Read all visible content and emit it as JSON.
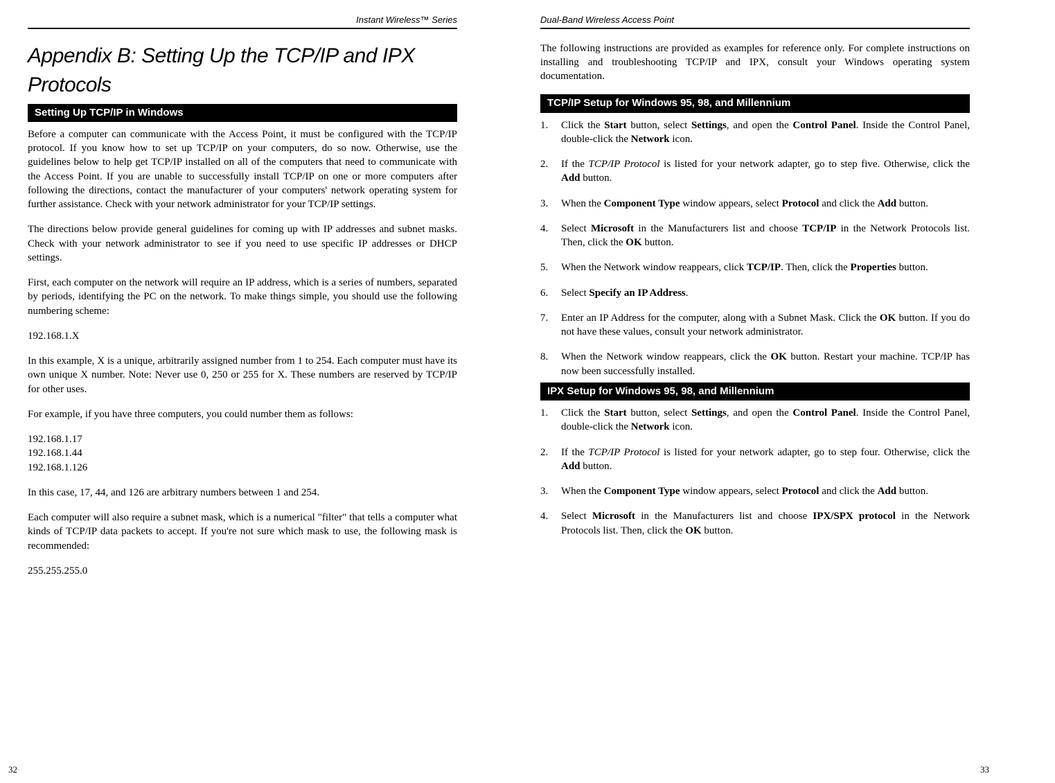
{
  "left": {
    "header": "Instant Wireless™ Series",
    "title": "Appendix B: Setting Up the TCP/IP and IPX Protocols",
    "section1": "Setting Up TCP/IP in Windows",
    "p1": "Before a computer can communicate with the Access Point, it must be configured with the TCP/IP protocol. If you know how to set up TCP/IP on your computers, do so now. Otherwise, use the guidelines below to help get TCP/IP installed on all of the computers that need to communicate with the Access Point. If you are unable to successfully install TCP/IP on one or more computers after following the directions, contact the manufacturer of your computers' network operating system for further assistance. Check with your network administrator for your TCP/IP settings.",
    "p2": "The directions below provide general guidelines for coming up with IP addresses and subnet masks. Check with your network administrator to see if you need to use specific IP addresses or DHCP settings.",
    "p3": "First, each computer on the network will require an IP address, which is a series of numbers, separated by periods, identifying the PC on the network. To make things simple, you should use the following numbering scheme:",
    "ip_scheme": "192.168.1.X",
    "p4": "In this example, X is a unique, arbitrarily assigned number from 1 to 254. Each computer must have its own unique X number. Note: Never use 0, 250 or 255 for X. These numbers are reserved by TCP/IP for other uses.",
    "p5": "For example, if you have three computers, you could number them as follows:",
    "ip1": "192.168.1.17",
    "ip2": "192.168.1.44",
    "ip3": "192.168.1.126",
    "p6": "In this case, 17, 44, and 126 are arbitrary numbers between 1 and 254.",
    "p7": "Each computer will also require a subnet mask, which is a numerical \"filter\" that tells a computer what kinds of TCP/IP data packets to accept. If you're not sure which mask to use, the following mask is recommended:",
    "mask": "255.255.255.0",
    "page_num": "32"
  },
  "right": {
    "header": "Dual-Band Wireless Access Point",
    "intro": "The following instructions are provided as examples for reference only. For complete instructions on installing and troubleshooting TCP/IP and IPX, consult your Windows operating system documentation.",
    "section1": "TCP/IP Setup for Windows 95, 98, and Millennium",
    "tcp": {
      "s1a": "Click the ",
      "s1b": "Start",
      "s1c": " button, select ",
      "s1d": "Settings",
      "s1e": ", and open the ",
      "s1f": "Control Panel",
      "s1g": ". Inside the Control Panel, double-click the ",
      "s1h": "Network",
      "s1i": " icon.",
      "s2a": "If the ",
      "s2b": "TCP/IP Protocol",
      "s2c": " is listed for your network adapter, go to step five. Otherwise, click the ",
      "s2d": "Add",
      "s2e": " button.",
      "s3a": "When the ",
      "s3b": "Component Type",
      "s3c": " window appears, select ",
      "s3d": "Protocol",
      "s3e": " and click the ",
      "s3f": "Add",
      "s3g": " button.",
      "s4a": "Select ",
      "s4b": "Microsoft",
      "s4c": " in the Manufacturers list and choose ",
      "s4d": "TCP/IP",
      "s4e": " in the Network Protocols list. Then, click the ",
      "s4f": "OK",
      "s4g": " button.",
      "s5a": "When the Network window reappears, click ",
      "s5b": "TCP/IP",
      "s5c": ". Then, click the ",
      "s5d": "Properties",
      "s5e": " button.",
      "s6a": "Select ",
      "s6b": "Specify an IP Address",
      "s6c": ".",
      "s7a": "Enter an IP Address for the computer, along with a Subnet Mask. Click the ",
      "s7b": "OK",
      "s7c": " button. If you do not have these values, consult your network administrator.",
      "s8a": "When the Network window reappears, click the ",
      "s8b": "OK",
      "s8c": " button. Restart your machine. TCP/IP has now been successfully installed."
    },
    "section2": "IPX Setup for Windows 95, 98, and Millennium",
    "ipx": {
      "s1a": "Click the ",
      "s1b": "Start",
      "s1c": " button, select ",
      "s1d": "Settings",
      "s1e": ", and open the ",
      "s1f": "Control Panel",
      "s1g": ". Inside the Control Panel, double-click the ",
      "s1h": "Network",
      "s1i": " icon.",
      "s2a": "If the ",
      "s2b": "TCP/IP Protocol",
      "s2c": " is listed for your network adapter, go to step four. Otherwise, click the ",
      "s2d": "Add",
      "s2e": " button.",
      "s3a": "When the ",
      "s3b": "Component Type",
      "s3c": " window appears, select ",
      "s3d": "Protocol",
      "s3e": " and click the ",
      "s3f": "Add",
      "s3g": " button.",
      "s4a": "Select ",
      "s4b": "Microsoft",
      "s4c": " in the Manufacturers list and choose ",
      "s4d": "IPX/SPX protocol",
      "s4e": " in the Network Protocols list. Then, click the ",
      "s4f": "OK",
      "s4g": " button."
    },
    "page_num": "33"
  }
}
